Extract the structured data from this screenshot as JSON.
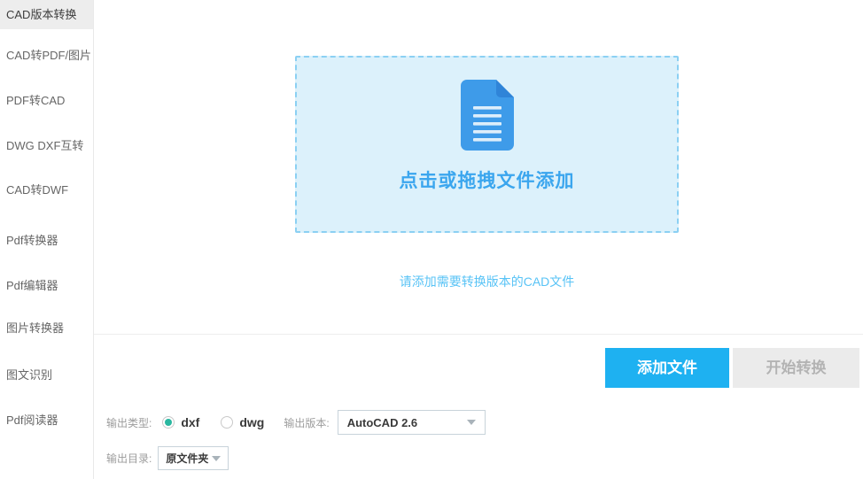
{
  "sidebar": {
    "items": [
      {
        "label": "CAD版本转换",
        "selected": true
      },
      {
        "label": "CAD转PDF/图片",
        "selected": false
      },
      {
        "label": "PDF转CAD",
        "selected": false
      },
      {
        "label": "DWG DXF互转",
        "selected": false
      },
      {
        "label": "CAD转DWF",
        "selected": false
      },
      {
        "label": "Pdf转换器",
        "selected": false
      },
      {
        "label": "Pdf编辑器",
        "selected": false
      },
      {
        "label": "图片转换器",
        "selected": false
      },
      {
        "label": "图文识别",
        "selected": false
      },
      {
        "label": "Pdf阅读器",
        "selected": false
      }
    ]
  },
  "dropzone": {
    "label": "点击或拖拽文件添加",
    "icon": "document-icon"
  },
  "hint": "请添加需要转换版本的CAD文件",
  "actions": {
    "add_files_label": "添加文件",
    "start_convert_label": "开始转换",
    "start_convert_enabled": false
  },
  "output": {
    "type_label": "输出类型:",
    "type_options": [
      {
        "label": "dxf",
        "selected": true
      },
      {
        "label": "dwg",
        "selected": false
      }
    ],
    "version_label": "输出版本:",
    "version_value": "AutoCAD 2.6",
    "dir_label": "输出目录:",
    "dir_value": "原文件夹"
  },
  "colors": {
    "accent_blue": "#1eb1f1",
    "dropzone_bg": "#dcf1fb",
    "dropzone_border": "#8bd0f3",
    "dropzone_text": "#3ba6ee",
    "doc_icon_blue": "#3e9be9",
    "hint_blue": "#58c3f6",
    "radio_teal": "#2ab7a0",
    "selected_item_bg": "#ededed",
    "disabled_button_bg": "#ebebeb"
  }
}
